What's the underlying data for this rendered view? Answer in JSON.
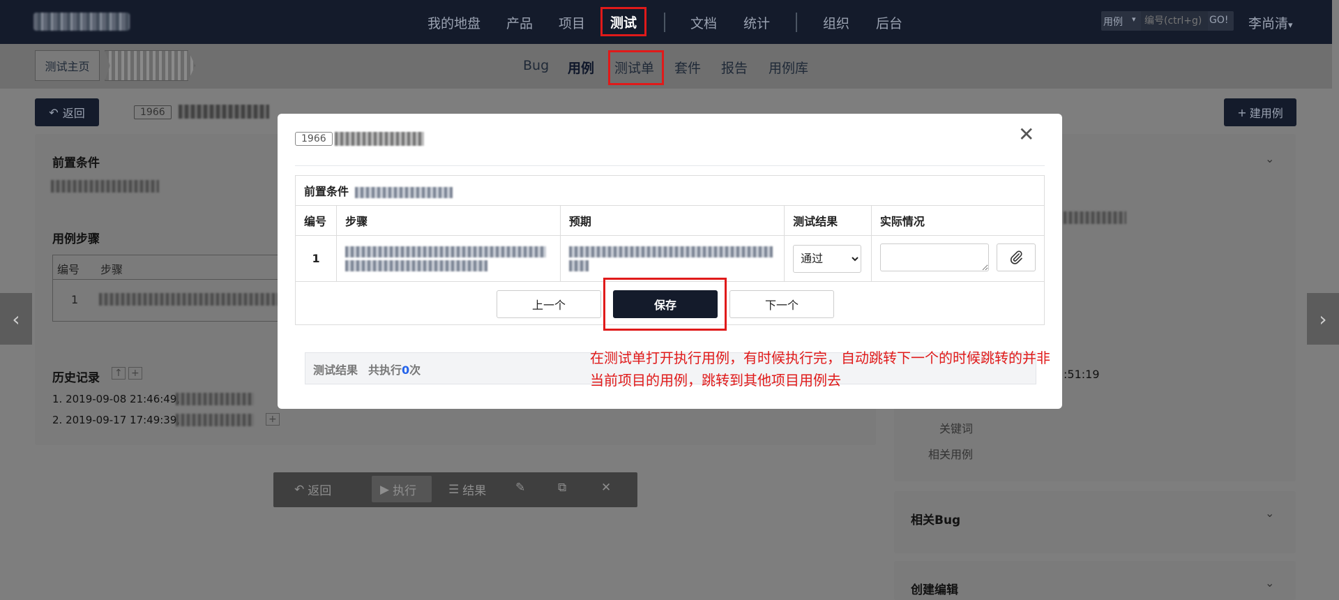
{
  "navbar": {
    "main_links": [
      "我的地盘",
      "产品",
      "项目",
      "测试",
      "文档",
      "统计",
      "组织",
      "后台"
    ],
    "active": "测试",
    "search": {
      "type": "用例",
      "placeholder": "编号(ctrl+g)",
      "go": "GO!"
    },
    "user": "李尚清"
  },
  "subnav": {
    "breadcrumb_home": "测试主页",
    "links": [
      "Bug",
      "用例",
      "测试单",
      "套件",
      "报告",
      "用例库"
    ],
    "active": "用例"
  },
  "page": {
    "back": "返回",
    "case_id": "1966",
    "new_case": "建用例",
    "precondition_heading": "前置条件",
    "steps_heading": "用例步骤",
    "steps_cols": [
      "编号",
      "步骤"
    ],
    "steps_row_num": "1",
    "history_heading": "历史记录",
    "history": [
      "1. 2019-09-08 21:46:49,",
      "2. 2019-09-17 17:49:39,"
    ],
    "right_time_fragment": ":51:19",
    "right_labels": [
      "关键词",
      "相关用例"
    ],
    "right_sections": [
      "相关Bug",
      "创建编辑"
    ]
  },
  "toolbar": {
    "items": [
      "返回",
      "执行",
      "结果"
    ]
  },
  "modal": {
    "case_id": "1966",
    "precondition_label": "前置条件",
    "columns": [
      "编号",
      "步骤",
      "预期",
      "测试结果",
      "实际情况"
    ],
    "rows": [
      {
        "num": "1",
        "result": "通过"
      }
    ],
    "result_options": [
      "通过"
    ],
    "prev": "上一个",
    "save": "保存",
    "next": "下一个",
    "result_bar": {
      "label": "测试结果",
      "count_prefix": "共执行",
      "count": "0",
      "count_suffix": "次"
    }
  },
  "annotation": "在测试单打开执行用例，有时候执行完，自动跳转下一个的时候跳转的并非当前项目的用例，跳转到其他项目用例去",
  "colors": {
    "highlight": "#e01a1a",
    "navbar": "#141b2b",
    "link": "#2463eb"
  }
}
